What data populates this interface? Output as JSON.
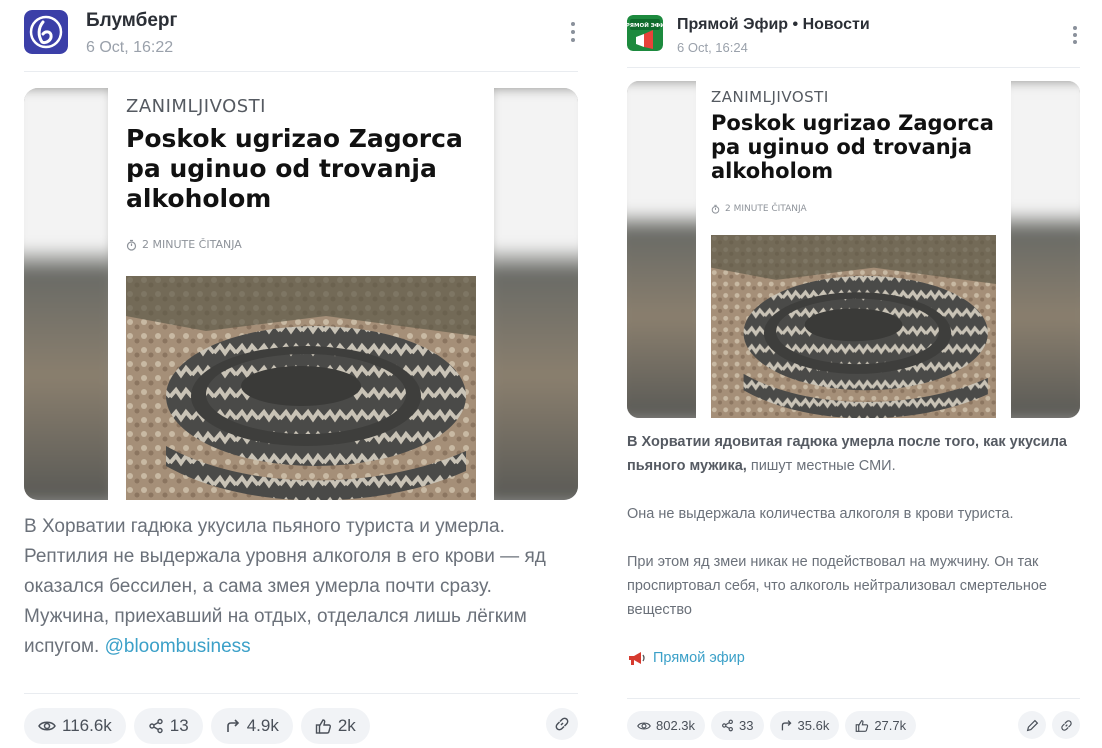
{
  "left_post": {
    "channel": "Блумберг",
    "date": "6 Oct, 16:22",
    "article": {
      "category": "ZANIMLJIVOSTI",
      "title": "Poskok ugrizao Zagorca pa uginuo od trovanja alkoholom",
      "read_time": "2 MINUTE ČITANJA"
    },
    "text": "В Хорватии гадюка укусила пьяного туриста и умерла. Рептилия не выдержала уровня алкоголя в его крови — яд оказался бессилен, а сама змея умерла почти сразу. Мужчина, приехавший на отдых, отделался лишь лёгким испугом. ",
    "mention": "@bloombusiness",
    "stats": {
      "views": "116.6k",
      "shares": "13",
      "reposts": "4.9k",
      "likes": "2k"
    }
  },
  "right_post": {
    "channel": "Прямой Эфир • Новости",
    "date": "6 Oct, 16:24",
    "avatar_text": "ПРЯМОЙ ЭФИР",
    "article": {
      "category": "ZANIMLJIVOSTI",
      "title": "Poskok ugrizao Zagorca pa uginuo od trovanja alkoholom",
      "read_time": "2 MINUTE ČITANJA"
    },
    "text_bold": "В Хорватии ядовитая гадюка умерла после того, как укусила пьяного мужика,",
    "text_rest": " пишут местные СМИ.",
    "paragraph2": "Она не выдержала количества алкоголя в крови туриста.",
    "paragraph3": "При этом яд змеи никак не подействовал на мужчину. Он так проспиртовал себя, что алкоголь нейтрализовал смертельное вещество",
    "source_link": "Прямой эфир",
    "stats": {
      "views": "802.3k",
      "shares": "33",
      "reposts": "35.6k",
      "likes": "27.7k"
    }
  },
  "colors": {
    "accent_link": "#3ba0c8",
    "pill_bg": "#f1f3f6",
    "bloomberg_avatar": "#3b3fa8",
    "efir_avatar": "#1d8a3e"
  },
  "icons": [
    "more-vertical-icon",
    "eye-icon",
    "share-nodes-icon",
    "repost-arrow-icon",
    "thumbs-up-icon",
    "link-icon",
    "pencil-icon",
    "megaphone-icon",
    "stopwatch-icon"
  ]
}
